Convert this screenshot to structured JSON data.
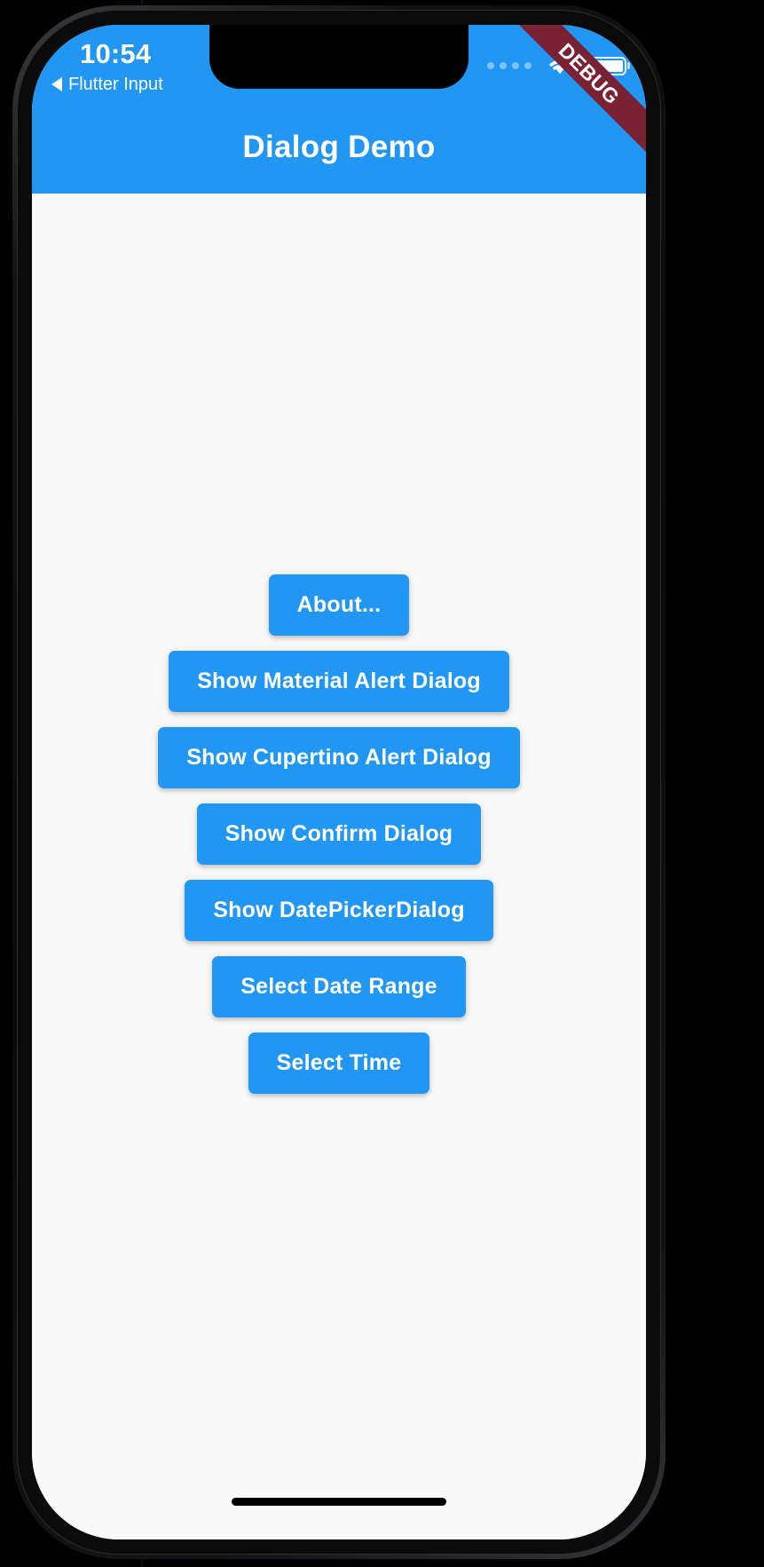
{
  "status_bar": {
    "time": "10:54",
    "back_label": "Flutter Input",
    "back_icon": "triangle-left-icon",
    "signal_icon": "signal-dots-icon",
    "wifi_icon": "wifi-icon",
    "battery_icon": "battery-full-icon"
  },
  "debug_banner": {
    "label": "DEBUG",
    "color": "#7a2133"
  },
  "app_bar": {
    "title": "Dialog Demo",
    "color": "#2196f3"
  },
  "body": {
    "background": "#f9f9f9",
    "buttons": [
      {
        "label": "About..."
      },
      {
        "label": "Show Material Alert Dialog"
      },
      {
        "label": "Show Cupertino Alert Dialog"
      },
      {
        "label": "Show Confirm Dialog"
      },
      {
        "label": "Show DatePickerDialog"
      },
      {
        "label": "Select Date Range"
      },
      {
        "label": "Select Time"
      }
    ],
    "button_color": "#2196f3",
    "button_text_color": "#ffffff"
  },
  "home_indicator": {
    "name": "home-indicator"
  }
}
